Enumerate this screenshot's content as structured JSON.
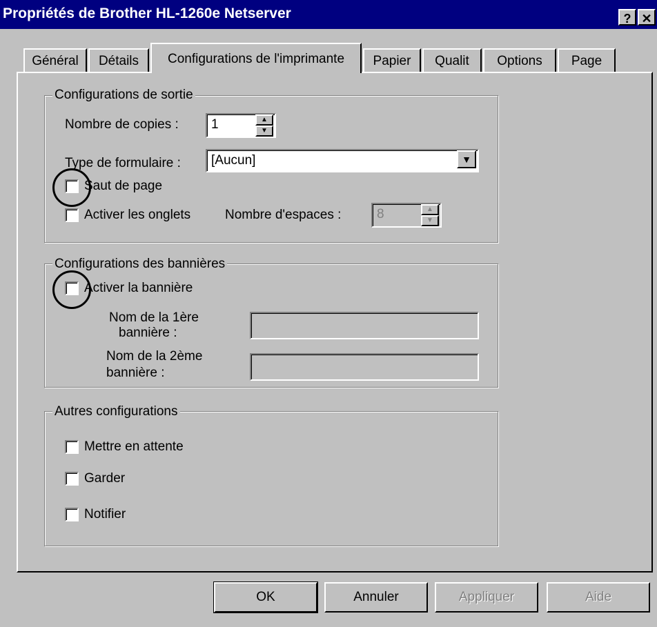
{
  "window": {
    "title": "Propriétés de Brother HL-1260e Netserver",
    "help_button": "?",
    "close_button": "✕"
  },
  "tabs": [
    {
      "label": "Général",
      "active": false
    },
    {
      "label": "Détails",
      "active": false
    },
    {
      "label": "Configurations de l'imprimante",
      "active": true
    },
    {
      "label": "Papier",
      "active": false
    },
    {
      "label": "Qualit",
      "active": false
    },
    {
      "label": "Options",
      "active": false
    },
    {
      "label": "Page",
      "active": false
    }
  ],
  "output_group": {
    "legend": "Configurations de sortie",
    "copies_label": "Nombre de copies :",
    "copies_value": "1",
    "form_type_label": "Type de formulaire :",
    "form_type_value": "[Aucun]",
    "page_break_label": "Saut de page",
    "page_break_checked": false,
    "tabs_enable_label": "Activer les onglets",
    "tabs_enable_checked": false,
    "spaces_label": "Nombre d'espaces :",
    "spaces_value": "8"
  },
  "banner_group": {
    "legend": "Configurations des bannières",
    "enable_label": "Activer la bannière",
    "enable_checked": false,
    "first_name_label_1": "Nom de la 1ère",
    "first_name_label_2": "bannière :",
    "second_name_label_1": "Nom de la 2ème",
    "second_name_label_2": "bannière :",
    "first_name_value": "",
    "second_name_value": ""
  },
  "other_group": {
    "legend": "Autres configurations",
    "hold_label": "Mettre en attente",
    "hold_checked": false,
    "keep_label": "Garder",
    "keep_checked": false,
    "notify_label": "Notifier",
    "notify_checked": false
  },
  "buttons": {
    "ok": "OK",
    "cancel": "Annuler",
    "apply": "Appliquer",
    "help": "Aide"
  },
  "colors": {
    "titlebar": "#000080",
    "face": "#c0c0c0"
  }
}
